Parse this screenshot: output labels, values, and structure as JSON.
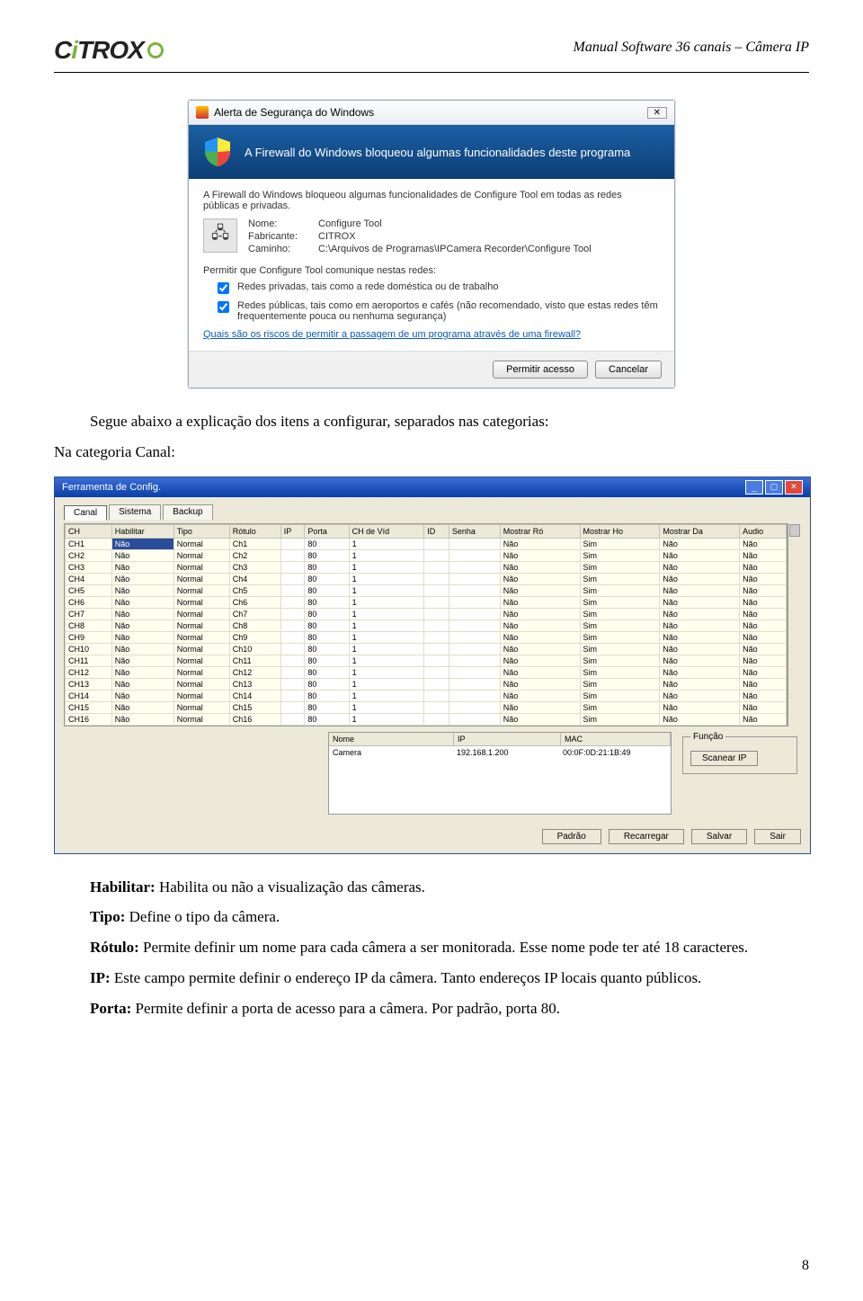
{
  "header": {
    "logo_left": "C",
    "logo_mid": "i",
    "logo_right": "TROX",
    "title": "Manual Software 36 canais – Câmera IP"
  },
  "firewall": {
    "window_title": "Alerta de Segurança do Windows",
    "banner": "A Firewall do Windows bloqueou algumas funcionalidades deste programa",
    "desc": "A Firewall do Windows bloqueou algumas funcionalidades de Configure Tool em todas as redes públicas e privadas.",
    "name_lbl": "Nome:",
    "name_val": "Configure Tool",
    "maker_lbl": "Fabricante:",
    "maker_val": "CITROX",
    "path_lbl": "Caminho:",
    "path_val": "C:\\Arquivos de Programas\\IPCamera Recorder\\Configure Tool",
    "permit_intro": "Permitir que Configure Tool comunique nestas redes:",
    "cb1": "Redes privadas, tais como a rede doméstica ou de trabalho",
    "cb2": "Redes públicas, tais como em aeroportos e cafés (não recomendado, visto que estas redes têm frequentemente pouca ou nenhuma segurança)",
    "link": "Quais são os riscos de permitir a passagem de um programa através de uma firewall?",
    "btn_allow": "Permitir acesso",
    "btn_cancel": "Cancelar"
  },
  "text": {
    "intro_top": "Segue abaixo a explicação dos itens a configurar, separados nas categorias:",
    "cat_label": "Na categoria Canal:",
    "p1b": "Habilitar:",
    "p1": " Habilita ou não a visualização das câmeras.",
    "p2b": "Tipo:",
    "p2": " Define o tipo da câmera.",
    "p3b": "Rótulo:",
    "p3": " Permite definir um nome para cada câmera a ser monitorada. Esse nome pode ter até 18 caracteres.",
    "p4b": "IP:",
    "p4": " Este campo permite definir o endereço IP da câmera. Tanto endereços IP locais quanto públicos.",
    "p5b": "Porta:",
    "p5": " Permite definir a porta de acesso para a câmera. Por padrão, porta 80."
  },
  "config": {
    "title": "Ferramenta de Config.",
    "tabs": [
      "Canal",
      "Sistema",
      "Backup"
    ],
    "headers": [
      "CH",
      "Habilitar",
      "Tipo",
      "Rótulo",
      "IP",
      "Porta",
      "CH de Víd",
      "ID",
      "Senha",
      "Mostrar Ró",
      "Mostrar Ho",
      "Mostrar Da",
      "Audio"
    ],
    "rows": [
      {
        "ch": "CH1",
        "hab": "Não",
        "tipo": "Normal",
        "rot": "Ch1",
        "ip": "",
        "porta": "80",
        "chv": "1",
        "id": "",
        "senha": "",
        "mr": "Não",
        "mh": "Sim",
        "md": "Não",
        "nao4": "Não",
        "aud": "Não",
        "sel": true
      },
      {
        "ch": "CH2",
        "hab": "Não",
        "tipo": "Normal",
        "rot": "Ch2",
        "ip": "",
        "porta": "80",
        "chv": "1",
        "id": "",
        "senha": "",
        "mr": "Não",
        "mh": "Sim",
        "md": "Não",
        "nao4": "Não",
        "aud": "Não"
      },
      {
        "ch": "CH3",
        "hab": "Não",
        "tipo": "Normal",
        "rot": "Ch3",
        "ip": "",
        "porta": "80",
        "chv": "1",
        "id": "",
        "senha": "",
        "mr": "Não",
        "mh": "Sim",
        "md": "Não",
        "nao4": "Não",
        "aud": "Não"
      },
      {
        "ch": "CH4",
        "hab": "Não",
        "tipo": "Normal",
        "rot": "Ch4",
        "ip": "",
        "porta": "80",
        "chv": "1",
        "id": "",
        "senha": "",
        "mr": "Não",
        "mh": "Sim",
        "md": "Não",
        "nao4": "Não",
        "aud": "Não"
      },
      {
        "ch": "CH5",
        "hab": "Não",
        "tipo": "Normal",
        "rot": "Ch5",
        "ip": "",
        "porta": "80",
        "chv": "1",
        "id": "",
        "senha": "",
        "mr": "Não",
        "mh": "Sim",
        "md": "Não",
        "nao4": "Não",
        "aud": "Não"
      },
      {
        "ch": "CH6",
        "hab": "Não",
        "tipo": "Normal",
        "rot": "Ch6",
        "ip": "",
        "porta": "80",
        "chv": "1",
        "id": "",
        "senha": "",
        "mr": "Não",
        "mh": "Sim",
        "md": "Não",
        "nao4": "Não",
        "aud": "Não"
      },
      {
        "ch": "CH7",
        "hab": "Não",
        "tipo": "Normal",
        "rot": "Ch7",
        "ip": "",
        "porta": "80",
        "chv": "1",
        "id": "",
        "senha": "",
        "mr": "Não",
        "mh": "Sim",
        "md": "Não",
        "nao4": "Não",
        "aud": "Não"
      },
      {
        "ch": "CH8",
        "hab": "Não",
        "tipo": "Normal",
        "rot": "Ch8",
        "ip": "",
        "porta": "80",
        "chv": "1",
        "id": "",
        "senha": "",
        "mr": "Não",
        "mh": "Sim",
        "md": "Não",
        "nao4": "Não",
        "aud": "Não"
      },
      {
        "ch": "CH9",
        "hab": "Não",
        "tipo": "Normal",
        "rot": "Ch9",
        "ip": "",
        "porta": "80",
        "chv": "1",
        "id": "",
        "senha": "",
        "mr": "Não",
        "mh": "Sim",
        "md": "Não",
        "nao4": "Não",
        "aud": "Não"
      },
      {
        "ch": "CH10",
        "hab": "Não",
        "tipo": "Normal",
        "rot": "Ch10",
        "ip": "",
        "porta": "80",
        "chv": "1",
        "id": "",
        "senha": "",
        "mr": "Não",
        "mh": "Sim",
        "md": "Não",
        "nao4": "Não",
        "aud": "Não"
      },
      {
        "ch": "CH11",
        "hab": "Não",
        "tipo": "Normal",
        "rot": "Ch11",
        "ip": "",
        "porta": "80",
        "chv": "1",
        "id": "",
        "senha": "",
        "mr": "Não",
        "mh": "Sim",
        "md": "Não",
        "nao4": "Não",
        "aud": "Não"
      },
      {
        "ch": "CH12",
        "hab": "Não",
        "tipo": "Normal",
        "rot": "Ch12",
        "ip": "",
        "porta": "80",
        "chv": "1",
        "id": "",
        "senha": "",
        "mr": "Não",
        "mh": "Sim",
        "md": "Não",
        "nao4": "Não",
        "aud": "Não"
      },
      {
        "ch": "CH13",
        "hab": "Não",
        "tipo": "Normal",
        "rot": "Ch13",
        "ip": "",
        "porta": "80",
        "chv": "1",
        "id": "",
        "senha": "",
        "mr": "Não",
        "mh": "Sim",
        "md": "Não",
        "nao4": "Não",
        "aud": "Não"
      },
      {
        "ch": "CH14",
        "hab": "Não",
        "tipo": "Normal",
        "rot": "Ch14",
        "ip": "",
        "porta": "80",
        "chv": "1",
        "id": "",
        "senha": "",
        "mr": "Não",
        "mh": "Sim",
        "md": "Não",
        "nao4": "Não",
        "aud": "Não"
      },
      {
        "ch": "CH15",
        "hab": "Não",
        "tipo": "Normal",
        "rot": "Ch15",
        "ip": "",
        "porta": "80",
        "chv": "1",
        "id": "",
        "senha": "",
        "mr": "Não",
        "mh": "Sim",
        "md": "Não",
        "nao4": "Não",
        "aud": "Não"
      },
      {
        "ch": "CH16",
        "hab": "Não",
        "tipo": "Normal",
        "rot": "Ch16",
        "ip": "",
        "porta": "80",
        "chv": "1",
        "id": "",
        "senha": "",
        "mr": "Não",
        "mh": "Sim",
        "md": "Não",
        "nao4": "Não",
        "aud": "Não"
      }
    ],
    "list_headers": [
      "Nome",
      "IP",
      "MAC"
    ],
    "list_row": {
      "nome": "Camera",
      "ip": "192.168.1.200",
      "mac": "00:0F:0D:21:1B:49"
    },
    "func_label": "Função",
    "scan_btn": "Scanear IP",
    "btn_default": "Padrão",
    "btn_reload": "Recarregar",
    "btn_save": "Salvar",
    "btn_exit": "Sair"
  },
  "pagenum": "8"
}
